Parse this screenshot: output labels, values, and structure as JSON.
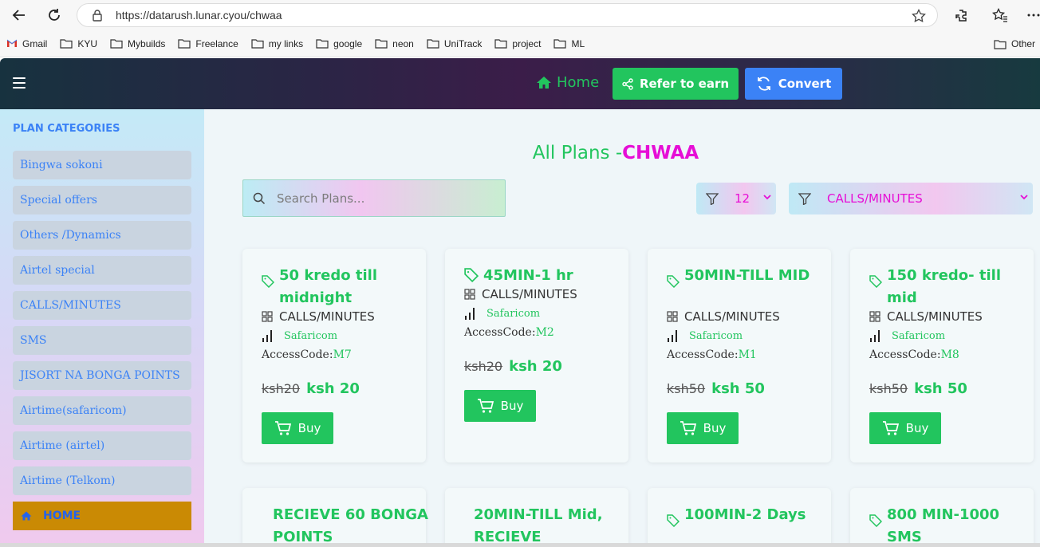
{
  "browser": {
    "url": "https://datarush.lunar.cyou/chwaa",
    "bookmarks": [
      "Gmail",
      "KYU",
      "Mybuilds",
      "Freelance",
      "my links",
      "google",
      "neon",
      "UniTrack",
      "project",
      "ML"
    ],
    "other_bookmarks": "Other"
  },
  "header": {
    "home_label": "Home",
    "refer_label": "Refer to earn",
    "convert_label": "Convert"
  },
  "sidebar": {
    "title": "PLAN CATEGORIES",
    "items": [
      "Bingwa sokoni",
      "Special offers",
      "Others /Dynamics",
      "Airtel special",
      "CALLS/MINUTES",
      "SMS",
      "JISORT NA BONGA POINTS",
      "Airtime(safaricom)",
      "Airtime (airtel)",
      "Airtime (Telkom)"
    ],
    "home_label": "HOME"
  },
  "main": {
    "title_prefix": "All Plans -",
    "title_highlight": "CHWAA",
    "search_placeholder": "Search Plans...",
    "filter_count": "12",
    "filter_category": "CALLS/MINUTES",
    "plans": [
      {
        "title": "50 kredo till midnight",
        "category": "CALLS/MINUTES",
        "network": "Safaricom",
        "code_label": "AccessCode:",
        "code": "M7",
        "old_price": "ksh20",
        "price": "ksh 20",
        "buy": "Buy"
      },
      {
        "title": "45MIN-1 hr",
        "category": "CALLS/MINUTES",
        "network": "Safaricom",
        "code_label": "AccessCode:",
        "code": "M2",
        "old_price": "ksh20",
        "price": "ksh 20",
        "buy": "Buy"
      },
      {
        "title": "50MIN-TILL MID",
        "category": "CALLS/MINUTES",
        "network": "Safaricom",
        "code_label": "AccessCode:",
        "code": "M1",
        "old_price": "ksh50",
        "price": "ksh 50",
        "buy": "Buy"
      },
      {
        "title": "150 kredo- till mid",
        "category": "CALLS/MINUTES",
        "network": "Safaricom",
        "code_label": "AccessCode:",
        "code": "M8",
        "old_price": "ksh50",
        "price": "ksh 50",
        "buy": "Buy"
      }
    ],
    "plans_row2": [
      {
        "title": "RECIEVE 60 BONGA POINTS"
      },
      {
        "title": "20MIN-TILL Mid, RECIEVE"
      },
      {
        "title": "100MIN-2 Days"
      },
      {
        "title": "800 MIN-1000 SMS"
      }
    ]
  }
}
